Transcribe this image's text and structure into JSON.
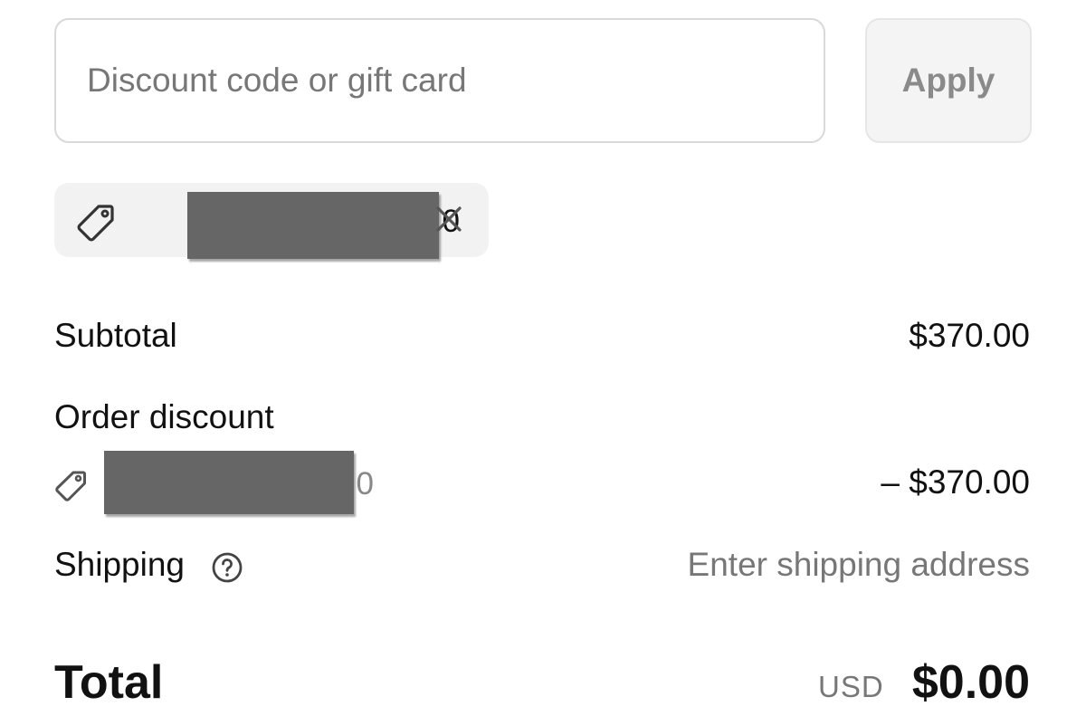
{
  "discount_form": {
    "placeholder": "Discount code or gift card",
    "value": "",
    "apply_label": "Apply"
  },
  "applied_code": {
    "visible_suffix": "0",
    "icon": "tag-icon",
    "remove_icon": "close-icon"
  },
  "summary": {
    "subtotal_label": "Subtotal",
    "subtotal_value": "$370.00",
    "order_discount_label": "Order discount",
    "discount_code_suffix": "0",
    "discount_value": "– $370.00",
    "shipping_label": "Shipping",
    "shipping_help_icon": "question-circle-icon",
    "shipping_value": "Enter shipping address",
    "total_label": "Total",
    "currency": "USD",
    "total_value": "$0.00"
  },
  "colors": {
    "text": "#111111",
    "muted": "#777777",
    "border": "#d9d9d9",
    "chip_bg": "#f2f2f2",
    "redaction": "#666666"
  }
}
